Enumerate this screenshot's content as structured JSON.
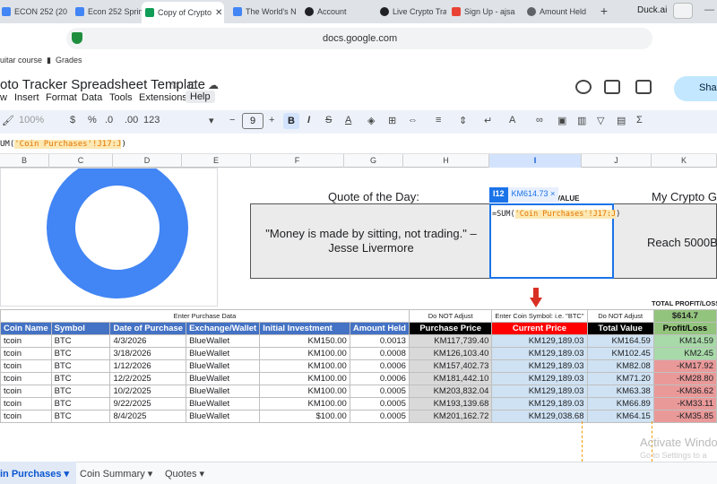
{
  "browser": {
    "tabs": [
      {
        "label": "ECON 252 (20",
        "color": "#4285f4"
      },
      {
        "label": "Econ 252 Sprin",
        "color": "#4285f4"
      },
      {
        "label": "Copy of Crypto",
        "color": "#0f9d58"
      },
      {
        "label": "The World's N",
        "color": "#4285f4"
      },
      {
        "label": "Account",
        "color": "#202124"
      },
      {
        "label": "Live Crypto Tra",
        "color": "#202124"
      },
      {
        "label": "Sign Up - ajsa",
        "color": "#ea4335"
      },
      {
        "label": "Amount Held",
        "color": "#5f6368"
      }
    ],
    "new_tab": "+",
    "duck_label": "Duck.ai",
    "url": "docs.google.com",
    "bookmarks": [
      "uitar course",
      "Grades"
    ]
  },
  "doc": {
    "title": "oto Tracker Spreadsheet Template",
    "menus": [
      "w",
      "Insert",
      "Format",
      "Data",
      "Tools",
      "Extensions",
      "Help"
    ],
    "share_label": "Shar"
  },
  "toolbar": {
    "zoom": "100%",
    "dollar": "$",
    "percent": "%",
    "dec_minus": ".0",
    "dec_plus": ".00",
    "num_format": "123",
    "font_size": "9",
    "bold": "B",
    "italic": "I",
    "strike": "S",
    "text_color": "A",
    "sigma": "Σ",
    "minus": "−",
    "plus": "+"
  },
  "formula_bar": {
    "prefix": "UM(",
    "string": "'Coin Purchases'!J17:J",
    "suffix": ")"
  },
  "columns": [
    "B",
    "C",
    "D",
    "E",
    "F",
    "G",
    "H",
    "I",
    "J",
    "K"
  ],
  "selected_column": "I",
  "quote_heading": "Quote of the Day:",
  "quote_text": "\"Money is made by sitting, not trading.\" – Jesse Livermore",
  "crypto_heading": "My Crypto Go",
  "goal_text": "Reach 5000B",
  "value_fragment": "VALUE",
  "edit_cell": {
    "ref": "I12",
    "preview": "KM614.73",
    "preview_close": "×",
    "formula_prefix": "=SUM(",
    "formula_string": "'Coin Purchases'!J17:J",
    "formula_suffix": ")"
  },
  "profit_header": "TOTAL PROFIT/LOSS",
  "profit_value": "$614.7",
  "subheaders": {
    "purchase_data": "Enter Purchase Data",
    "do_not_adjust_1": "Do NOT Adjust",
    "coin_symbol": "Enter Coin Symbol: i.e. \"BTC\"",
    "do_not_adjust_2": "Do NOT Adjust"
  },
  "table": {
    "headers": [
      "Coin Name",
      "Symbol",
      "Date of Purchase",
      "Exchange/Wallet",
      "Initial Investment",
      "Amount Held",
      "Purchase Price",
      "Current Price",
      "Total Value",
      "Profit/Loss"
    ],
    "rows": [
      [
        "tcoin",
        "BTC",
        "4/3/2026",
        "BlueWallet",
        "KM150.00",
        "0.0013",
        "KM117,739.40",
        "KM129,189.03",
        "KM164.59",
        "KM14.59"
      ],
      [
        "tcoin",
        "BTC",
        "3/18/2026",
        "BlueWallet",
        "KM100.00",
        "0.0008",
        "KM126,103.40",
        "KM129,189.03",
        "KM102.45",
        "KM2.45"
      ],
      [
        "tcoin",
        "BTC",
        "1/12/2026",
        "BlueWallet",
        "KM100.00",
        "0.0006",
        "KM157,402.73",
        "KM129,189.03",
        "KM82.08",
        "-KM17.92"
      ],
      [
        "tcoin",
        "BTC",
        "12/2/2025",
        "BlueWallet",
        "KM100.00",
        "0.0006",
        "KM181,442.10",
        "KM129,189.03",
        "KM71.20",
        "-KM28.80"
      ],
      [
        "tcoin",
        "BTC",
        "10/2/2025",
        "BlueWallet",
        "KM100.00",
        "0.0005",
        "KM203,832.04",
        "KM129,189.03",
        "KM63.38",
        "-KM36.62"
      ],
      [
        "tcoin",
        "BTC",
        "9/22/2025",
        "BlueWallet",
        "KM100.00",
        "0.0005",
        "KM193,139.68",
        "KM129,189.03",
        "KM66.89",
        "-KM33.11"
      ],
      [
        "tcoin",
        "BTC",
        "8/4/2025",
        "BlueWallet",
        "$100.00",
        "0.0005",
        "KM201,162.72",
        "KM129,038.68",
        "KM64.15",
        "-KM35.85"
      ]
    ]
  },
  "sheet_tabs": [
    "in Purchases",
    "Coin Summary",
    "Quotes"
  ],
  "watermark": {
    "line1": "Activate Windo",
    "line2": "Go to Settings to a"
  },
  "colors": {
    "accent": "#1a73e8",
    "header_blue": "#4472c4",
    "loss_red": "#ea9999",
    "gain_green": "#a8d9a8"
  }
}
